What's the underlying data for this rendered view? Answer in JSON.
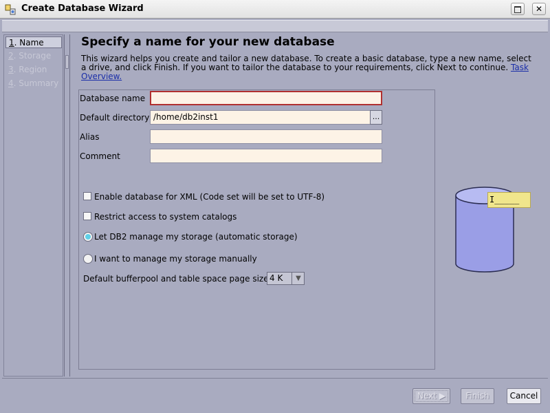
{
  "window": {
    "title": "Create Database Wizard",
    "close_glyph": "✕",
    "app_icon": "wizard-app-icon"
  },
  "nav": {
    "items": [
      {
        "num": "1",
        "label": "Name",
        "selected": true
      },
      {
        "num": "2",
        "label": "Storage",
        "selected": false
      },
      {
        "num": "3",
        "label": "Region",
        "selected": false
      },
      {
        "num": "4",
        "label": "Summary",
        "selected": false
      }
    ]
  },
  "page": {
    "title": "Specify a name for your new database",
    "intro": "This wizard helps you create and tailor a new database. To create a basic database, type a new name, select a drive, and click Finish. If you want to tailor the database to your requirements, click Next to continue.",
    "intro_link": "Task Overview."
  },
  "form": {
    "database_name_label": "Database name",
    "database_name_value": "",
    "default_directory_label": "Default directory",
    "default_directory_value": "/home/db2inst1",
    "browse_label": "...",
    "alias_label": "Alias",
    "alias_value": "",
    "comment_label": "Comment",
    "comment_value": "",
    "xml_checkbox_label": "Enable database for XML (Code set will be set to UTF-8)",
    "xml_checked": false,
    "restrict_checkbox_label": "Restrict access to system catalogs",
    "restrict_checked": false,
    "radio_auto_label": "Let DB2 manage my storage (automatic storage)",
    "radio_auto_selected": true,
    "radio_manual_label": "I want to manage my storage manually",
    "radio_manual_selected": false,
    "page_size_label": "Default bufferpool and table space page size",
    "page_size_value": "4 K"
  },
  "illustration": {
    "tooltip_text": "I_____"
  },
  "buttons": {
    "next": "Next ▶",
    "finish": "Finish",
    "cancel": "Cancel"
  },
  "colors": {
    "background": "#a9abc0",
    "field_background": "#fdf3e6",
    "required_border": "#b03030",
    "cylinder": "#9a9ee6",
    "tooltip": "#f0e68c"
  }
}
